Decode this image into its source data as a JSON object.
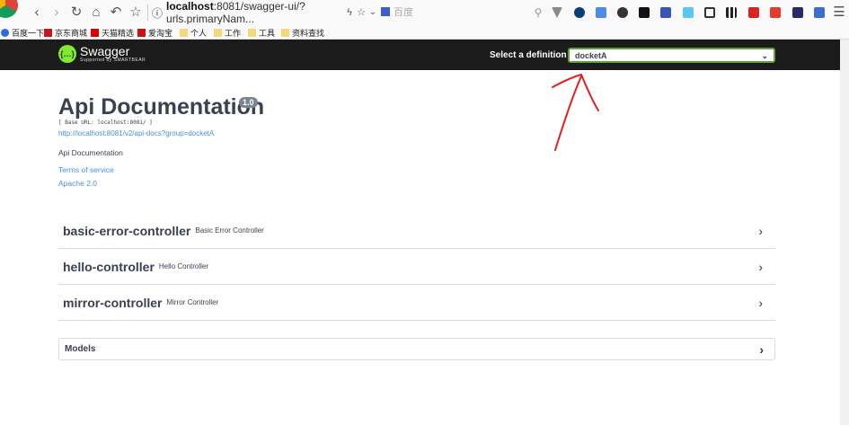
{
  "browser": {
    "url_host": "localhost",
    "url_rest": ":8081/swagger-ui/?urls.primaryNam...",
    "search_placeholder": "百度",
    "bookmarks": [
      "百度一下",
      "京东商城",
      "天猫精选",
      "爱淘宝",
      "个人",
      "工作",
      "工具",
      "资料查找"
    ]
  },
  "topbar": {
    "logo_name": "Swagger",
    "logo_sub": "Supported by SMARTBEAR",
    "definition_label": "Select a definition",
    "definition_value": "docketA"
  },
  "info": {
    "title": "Api Documentation",
    "version": "1.0",
    "base_url": "[ Base URL: localhost:8081/ ]",
    "api_docs_link": "http://localhost:8081/v2/api-docs?group=docketA",
    "description": "Api Documentation",
    "terms": "Terms of service",
    "license": "Apache 2.0"
  },
  "controllers": [
    {
      "name": "basic-error-controller",
      "desc": "Basic Error Controller"
    },
    {
      "name": "hello-controller",
      "desc": "Hello Controller"
    },
    {
      "name": "mirror-controller",
      "desc": "Mirror Controller"
    }
  ],
  "models": {
    "label": "Models"
  },
  "colors": {
    "accent": "#85ea2d",
    "topbar": "#1b1b1b",
    "link": "#4990e2",
    "annotation": "#e02020"
  }
}
